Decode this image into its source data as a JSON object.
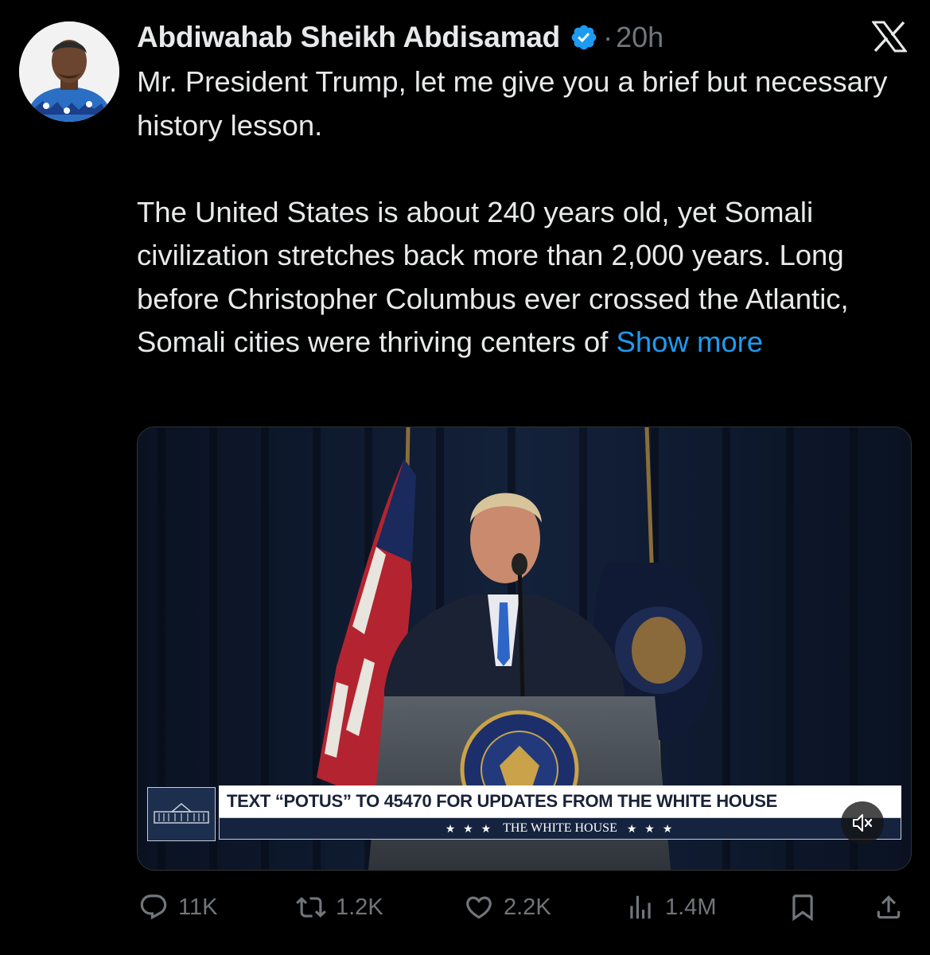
{
  "tweet": {
    "author": {
      "name": "Abdiwahab Sheikh Abdisamad",
      "verified": true
    },
    "separator": "·",
    "time": "20h",
    "text_paragraphs": [
      "Mr. President Trump, let me give you a brief but necessary history lesson.",
      "The United States is about 240 years old, yet Somali civilization stretches back more than 2,000 years. Long before Christopher Columbus ever crossed the Atlantic, Somali cities were thriving centers of"
    ],
    "show_more": "Show more"
  },
  "video": {
    "chyron_text": "TEXT “POTUS” TO 45470 FOR UPDATES FROM THE WHITE HOUSE",
    "chyron_stars": "★ ★ ★",
    "chyron_sub": "THE WHITE HOUSE",
    "muted": true
  },
  "actions": {
    "replies": "11K",
    "reposts": "1.2K",
    "likes": "2.2K",
    "views": "1.4M"
  },
  "icons": {
    "verified": "verified-badge-icon",
    "logo": "x-logo-icon",
    "reply": "reply-icon",
    "repost": "repost-icon",
    "like": "heart-icon",
    "views": "views-icon",
    "bookmark": "bookmark-icon",
    "share": "share-icon",
    "mute": "volume-muted-icon"
  },
  "colors": {
    "background": "#000000",
    "text": "#e7e9ea",
    "secondary": "#71767b",
    "accent": "#1d9bf0"
  }
}
